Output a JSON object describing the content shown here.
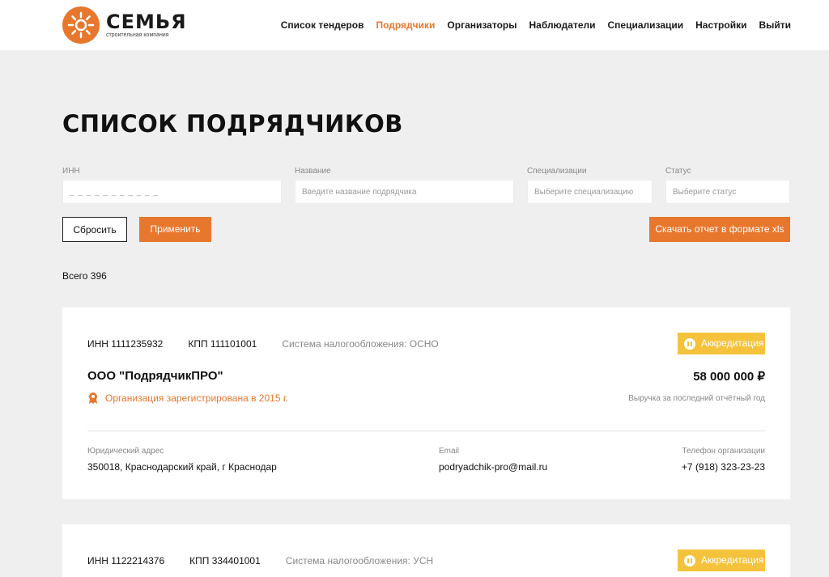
{
  "brand": {
    "name": "СЕМЬЯ",
    "subtitle": "строительная компания",
    "color": "#e8772e"
  },
  "nav": [
    {
      "label": "Список тендеров",
      "active": false
    },
    {
      "label": "Подрядчики",
      "active": true
    },
    {
      "label": "Организаторы",
      "active": false
    },
    {
      "label": "Наблюдатели",
      "active": false
    },
    {
      "label": "Специализации",
      "active": false
    },
    {
      "label": "Настройки",
      "active": false
    },
    {
      "label": "Выйти",
      "active": false
    }
  ],
  "page_title": "СПИСОК ПОДРЯДЧИКОВ",
  "filters": {
    "inn": {
      "label": "ИНН",
      "placeholder": "_ _ _ _ _ _ _ _ _ _ _"
    },
    "name": {
      "label": "Название",
      "placeholder": "Введите название подрядчика"
    },
    "spec": {
      "label": "Специализации",
      "placeholder": "Выберите специализацию"
    },
    "status": {
      "label": "Статус",
      "placeholder": "Выберите статус"
    }
  },
  "buttons": {
    "reset": "Сбросить",
    "apply": "Применить",
    "download": "Скачать отчет в формате xls"
  },
  "total": "Всего 396",
  "cards": [
    {
      "inn": "ИНН 1111235932",
      "kpp": "КПП 111101001",
      "tax": "Система налогообложения: ОСНО",
      "badge": "Аккредитация",
      "company": "ООО \"ПодрядчикПРО\"",
      "revenue": "58 000 000 ₽",
      "registered": "Организация зарегистрирована в 2015 г.",
      "revenue_label": "Выручка за последний отчётный год",
      "address_label": "Юридический адрес",
      "address": "350018, Краснодарский край, г Краснодар",
      "email_label": "Email",
      "email": "podryadchik-pro@mail.ru",
      "phone_label": "Телефон организации",
      "phone": "+7 (918) 323-23-23"
    },
    {
      "inn": "ИНН 1122214376",
      "kpp": "КПП 334401001",
      "tax": "Система налогообложения: УСН",
      "badge": "Аккредитация"
    }
  ]
}
